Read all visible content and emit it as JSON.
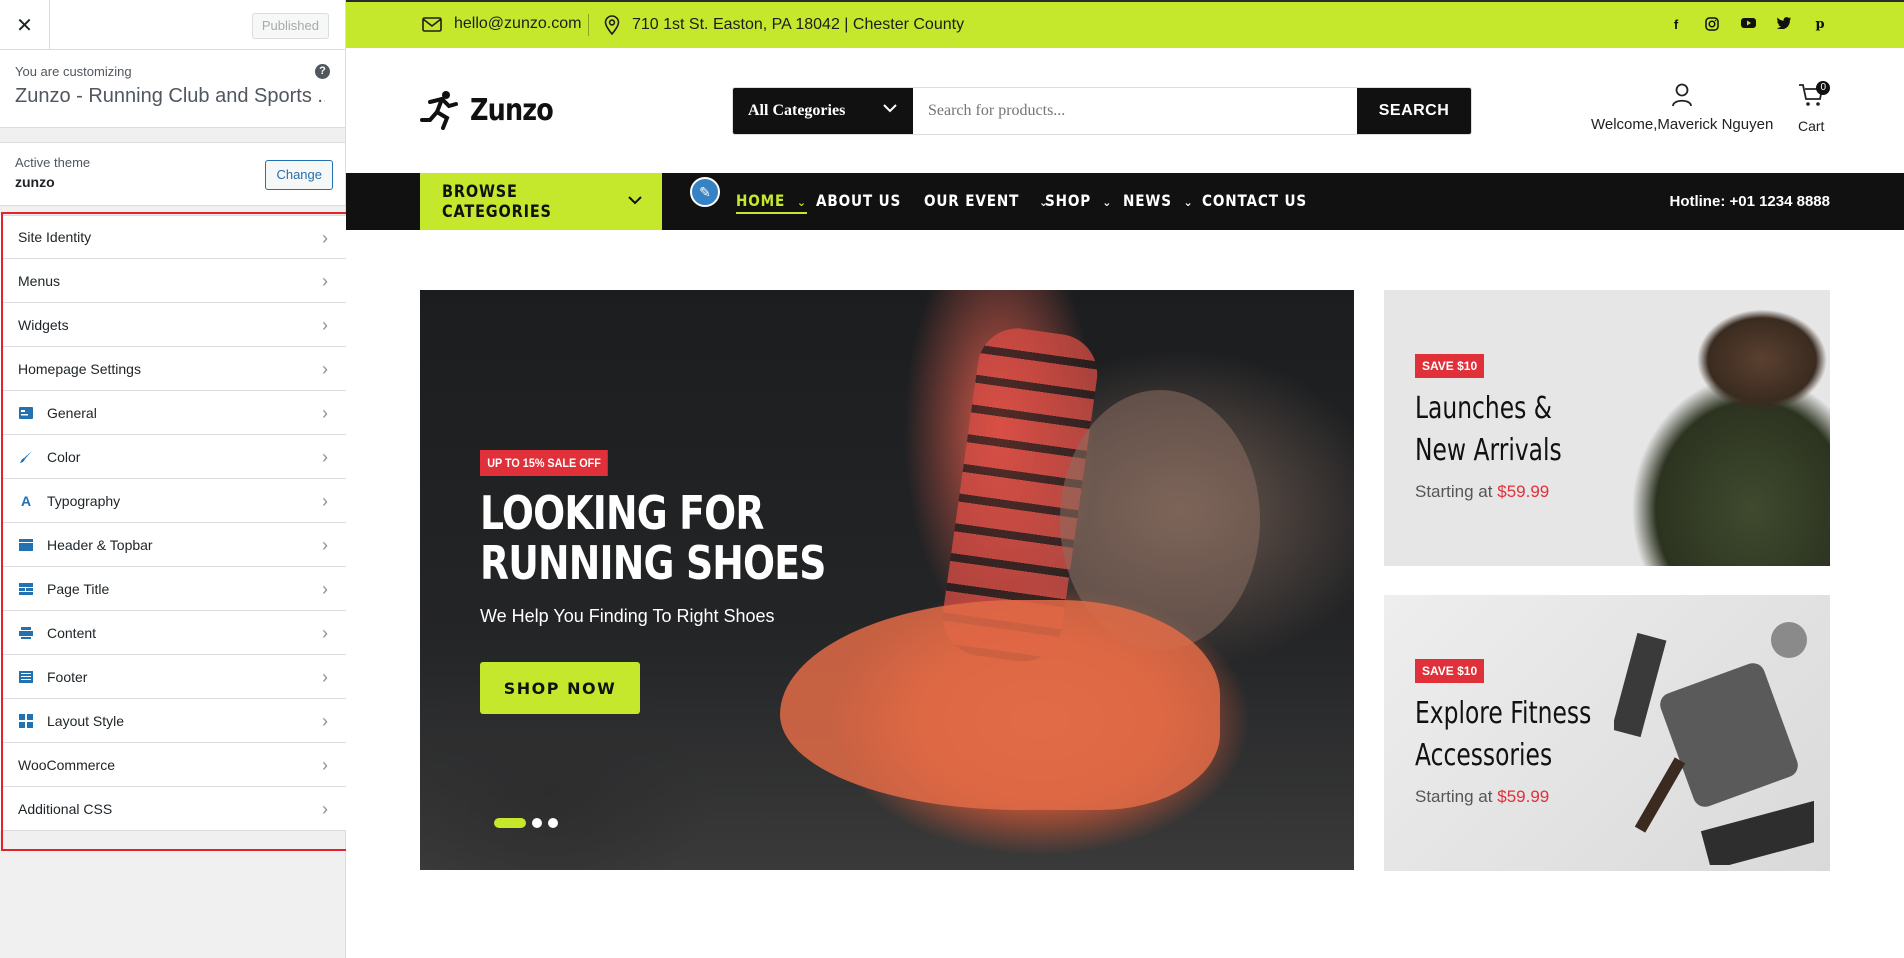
{
  "sidebar": {
    "close_icon": "close-icon",
    "published_label": "Published",
    "customizing_label": "You are customizing",
    "site_title": "Zunzo - Running Club and Sports ...",
    "help_icon": "?",
    "active_theme_label": "Active theme",
    "active_theme_name": "zunzo",
    "change_label": "Change",
    "panels": [
      {
        "label": "Site Identity",
        "icon": ""
      },
      {
        "label": "Menus",
        "icon": ""
      },
      {
        "label": "Widgets",
        "icon": ""
      },
      {
        "label": "Homepage Settings",
        "icon": ""
      },
      {
        "label": "General",
        "icon": "general-icon"
      },
      {
        "label": "Color",
        "icon": "brush-icon"
      },
      {
        "label": "Typography",
        "icon": "typography-icon"
      },
      {
        "label": "Header & Topbar",
        "icon": "header-icon"
      },
      {
        "label": "Page Title",
        "icon": "page-title-icon"
      },
      {
        "label": "Content",
        "icon": "content-icon"
      },
      {
        "label": "Footer",
        "icon": "footer-icon"
      },
      {
        "label": "Layout Style",
        "icon": "layout-icon"
      },
      {
        "label": "WooCommerce",
        "icon": ""
      },
      {
        "label": "Additional CSS",
        "icon": ""
      }
    ]
  },
  "topbar": {
    "email": "hello@zunzo.com",
    "address": "710 1st St. Easton, PA 18042 | Chester County",
    "social": [
      "facebook-icon",
      "instagram-icon",
      "youtube-icon",
      "twitter-icon",
      "pinterest-icon"
    ],
    "accent_color": "#c5e82c"
  },
  "header": {
    "logo_text": "Zunzo",
    "category_select": "All Categories",
    "search_placeholder": "Search for products...",
    "search_button": "SEARCH",
    "welcome": "Welcome,Maverick Nguyen",
    "cart_label": "Cart",
    "cart_count": "0"
  },
  "nav": {
    "browse": "BROWSE CATEGORIES",
    "items": [
      "HOME",
      "ABOUT US",
      "OUR EVENT",
      "SHOP",
      "NEWS",
      "CONTACT US"
    ],
    "hotline": "Hotline: +01 1234 8888"
  },
  "hero": {
    "badge": "UP TO 15% SALE OFF",
    "title_line1": "LOOKING FOR",
    "title_line2": "RUNNING SHOES",
    "subtitle": "We Help You Finding To Right Shoes",
    "button": "SHOP NOW",
    "slides_total": 3,
    "active_slide": 1
  },
  "promos": [
    {
      "badge": "SAVE $10",
      "title_line1": "Launches &",
      "title_line2": "New Arrivals",
      "price_prefix": "Starting at",
      "price": "$59.99"
    },
    {
      "badge": "SAVE $10",
      "title_line1": "Explore Fitness",
      "title_line2": "Accessories",
      "price_prefix": "Starting at",
      "price": "$59.99"
    }
  ]
}
